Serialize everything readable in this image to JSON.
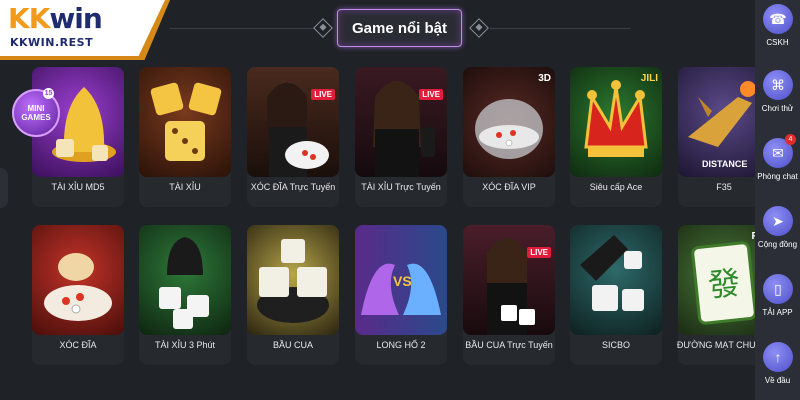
{
  "logo": {
    "main_k": "KK",
    "main_win": "win",
    "sub": "KKWIN.REST"
  },
  "header": {
    "title": "Game nổi bật"
  },
  "games_row1": [
    {
      "label": "TÀI XỈU MD5",
      "badge": ""
    },
    {
      "label": "TÀI XỈU",
      "badge": ""
    },
    {
      "label": "XÓC ĐĨA Trực Tuyến",
      "badge": "LIVE"
    },
    {
      "label": "TÀI XỈU Trực Tuyến",
      "badge": "LIVE"
    },
    {
      "label": "XÓC ĐĨA VIP",
      "badge": "3D"
    },
    {
      "label": "Siêu cấp Ace",
      "badge": "JILI"
    },
    {
      "label": "F35",
      "badge": "DISTANCE"
    }
  ],
  "games_row2": [
    {
      "label": "XÓC ĐĨA",
      "badge": ""
    },
    {
      "label": "TÀI XỈU 3 Phút",
      "badge": ""
    },
    {
      "label": "BẦU CUA",
      "badge": ""
    },
    {
      "label": "LONG HỔ 2",
      "badge": "VS"
    },
    {
      "label": "BẦU CUA Trực Tuyến",
      "badge": "LIVE"
    },
    {
      "label": "SICBO",
      "badge": ""
    },
    {
      "label": "ĐƯỜNG MẠT CHƯỢC",
      "badge": "PG"
    }
  ],
  "mini_games": {
    "line1": "MINI",
    "line2": "GAMES",
    "count": "15"
  },
  "sidebar": {
    "items": [
      {
        "label": "CSKH",
        "icon": "headset-icon",
        "glyph": "☎"
      },
      {
        "label": "Chơi thử",
        "icon": "gamepad-icon",
        "glyph": "⌘"
      },
      {
        "label": "Phòng chat",
        "icon": "chat-icon",
        "glyph": "✉",
        "notif": "4"
      },
      {
        "label": "Cộng đồng",
        "icon": "send-icon",
        "glyph": "➤"
      },
      {
        "label": "TẢI APP",
        "icon": "phone-icon",
        "glyph": "▯"
      },
      {
        "label": "Về đầu",
        "icon": "arrow-up-icon",
        "glyph": "↑"
      }
    ]
  },
  "colors": {
    "background": "#1f2226",
    "accent": "#c38be8",
    "logo_orange": "#f29a1b",
    "logo_navy": "#1e2b6e",
    "sidebar_icon": "#6667dd"
  }
}
